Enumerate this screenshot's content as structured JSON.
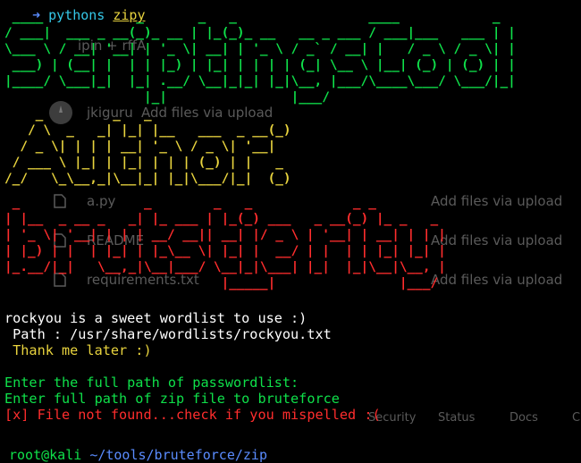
{
  "top_prompt": {
    "arrow": "➜",
    "app": "pythons",
    "item": "zipy"
  },
  "background": {
    "avatar_icon": "octocat-avatar-icon",
    "commit_user": "jkiguru",
    "commit_msg_top": "Add files via upload",
    "repo_fragment": "ipin + rffA",
    "files": [
      {
        "name": "a.py",
        "message": "Add files via upload"
      },
      {
        "name": "README",
        "message": "Add files via upload"
      },
      {
        "name": "requirements.txt",
        "message": "Add files via upload"
      }
    ],
    "footer_links": [
      "Security",
      "Status",
      "Docs",
      "C"
    ]
  },
  "banners": {
    "line1": " ____            _       _   _                 ____            _ \n/ ___|  ___ _ __(_)_ __ | |_(_)_ __   __ _ ___ / ___|___   ___ | |\n\\___ \\ / __| '__| | '_ \\| __| | '_ \\ / _` / __| |   / _ \\ / _ \\| |\n ___) | (__| |  | | |_) | |_| | | | | (_| \\__ \\ |__| (_) | (_) | |\n|____/ \\___|_|  |_| .__/ \\__|_|_| |_|\\__, |___/\\____\\___/ \\___/|_|\n                  |_|                |___/                        ",
    "line2": "    _         _   _                 \n   / \\  _   _| |_| |__   ___  _ __(_)\n  / _ \\| | | | __| '_ \\ / _ \\| '__|  \n / ___ \\ |_| | |_| | | | (_) | |   _ \n/_/   \\_\\__,_|\\__|_| |_|\\___/|_|  (_)",
    "line3": " _                _        _   _             _ _          \n| |__  _ __ _   _| |_ ___ | |_(_) ___   _ __(_) |_ _   _  \n| '_ \\| '__| | | | __/ __|| __| |/ _ \\ | '__| | __| | | | \n| |_) | |  | |_| | |_\\__ \\| |_| |  __/ | |  | | |_| |_| | \n|_.__/|_|   \\__,_|\\__|___/ \\__|_|\\___| |_|  |_|\\__|\\__, | \n                            |_____|                |___/  "
  },
  "messages": {
    "l1": "rockyou is a sweet wordlist to use :)",
    "l2": " Path : /usr/share/wordlists/rockyou.txt",
    "l3": " Thank me later :)",
    "l4": "Enter the full path of passwordlist:",
    "l5": "Enter full path of zip file to bruteforce",
    "l6": "[x] File not found...check if you mispelled :("
  },
  "bottom_prompt": {
    "user": "root@kali",
    "path": "~/tools/bruteforce/zip"
  },
  "colors": {
    "green": "#0fe04a",
    "yellow": "#e8d33e",
    "red": "#ff2d2d",
    "ghost": "#5a5a5a"
  }
}
